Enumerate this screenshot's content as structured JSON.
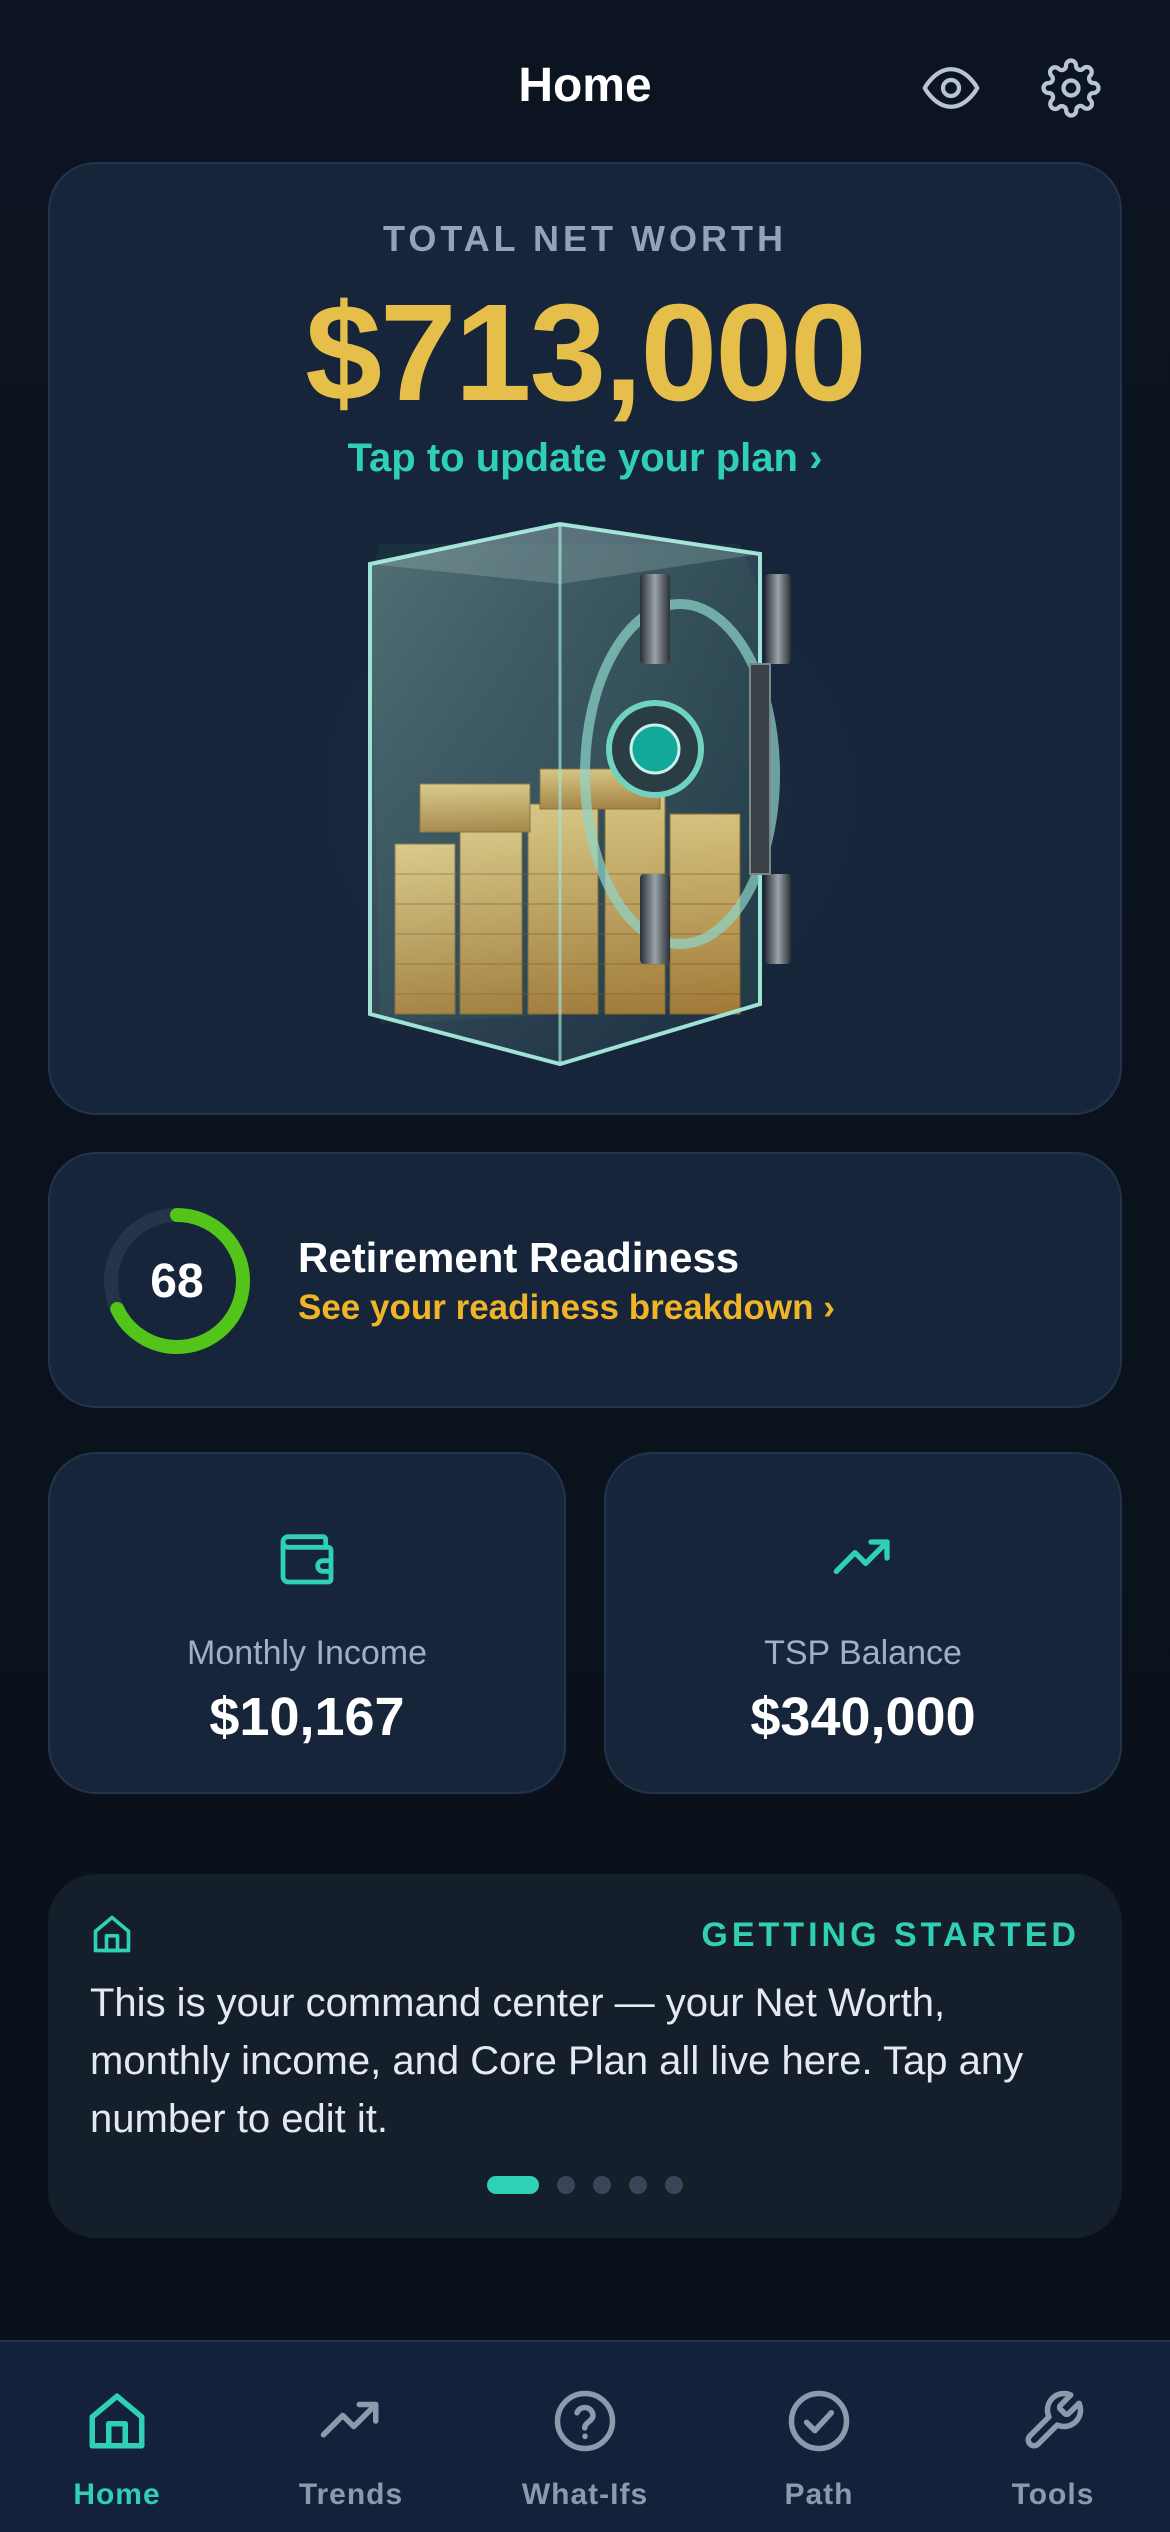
{
  "header": {
    "title": "Home",
    "eye_icon": "eye-icon",
    "settings_icon": "gear-icon"
  },
  "hero": {
    "label": "TOTAL NET WORTH",
    "amount": "$713,000",
    "update_link": "Tap to update your plan ›",
    "image": "glass-safe-with-gold-coins"
  },
  "readiness": {
    "score": "68",
    "score_fraction": 0.68,
    "title": "Retirement Readiness",
    "link": "See your readiness breakdown ›"
  },
  "stats": [
    {
      "icon": "wallet-icon",
      "label": "Monthly Income",
      "value": "$10,167"
    },
    {
      "icon": "trending-up-icon",
      "label": "TSP Balance",
      "value": "$340,000"
    }
  ],
  "tip": {
    "icon": "home-icon",
    "tag": "GETTING STARTED",
    "body": "This is your command center — your Net Worth, monthly income, and Core Plan all live here. Tap any number to edit it.",
    "page_count": 5,
    "active_page": 1
  },
  "tabs": [
    {
      "label": "Home",
      "icon": "home-icon",
      "active": true
    },
    {
      "label": "Trends",
      "icon": "trending-up-icon",
      "active": false
    },
    {
      "label": "What-Ifs",
      "icon": "question-circle-icon",
      "active": false
    },
    {
      "label": "Path",
      "icon": "check-circle-icon",
      "active": false
    },
    {
      "label": "Tools",
      "icon": "wrench-icon",
      "active": false
    }
  ],
  "colors": {
    "background": "#0b1420",
    "card": "#16253a",
    "accent_teal": "#2fd0b5",
    "gold": "#e6bf4a",
    "amber": "#f0b429",
    "ring_green": "#52c41a"
  }
}
